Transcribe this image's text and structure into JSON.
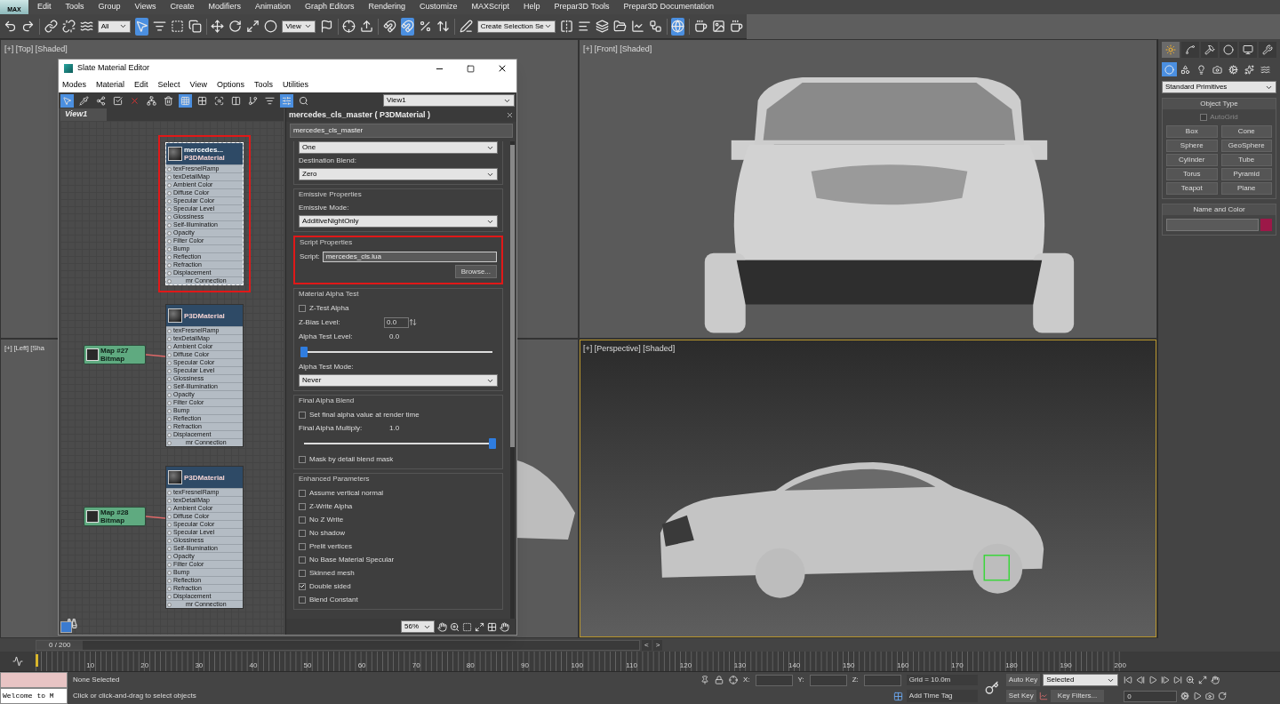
{
  "menu_bar": {
    "logo": "MAX",
    "items": [
      "Edit",
      "Tools",
      "Group",
      "Views",
      "Create",
      "Modifiers",
      "Animation",
      "Graph Editors",
      "Rendering",
      "Customize",
      "MAXScript",
      "Help",
      "Prepar3D Tools",
      "Prepar3D Documentation"
    ]
  },
  "toolbar": [
    {
      "kind": "button",
      "selected": false
    },
    {
      "kind": "button",
      "selected": false
    },
    {
      "kind": "sep"
    },
    {
      "kind": "button",
      "selected": false
    },
    {
      "kind": "button",
      "selected": false
    },
    {
      "kind": "button",
      "selected": false
    },
    {
      "kind": "dropdown",
      "value": "All"
    },
    {
      "kind": "button",
      "selected": true
    },
    {
      "kind": "button",
      "selected": false
    },
    {
      "kind": "button",
      "selected": false
    },
    {
      "kind": "button",
      "selected": false
    },
    {
      "kind": "sep"
    },
    {
      "kind": "button",
      "selected": false
    },
    {
      "kind": "button",
      "selected": false
    },
    {
      "kind": "button",
      "selected": false
    },
    {
      "kind": "button",
      "selected": false
    },
    {
      "kind": "dropdown",
      "value": "View"
    },
    {
      "kind": "button",
      "selected": false
    },
    {
      "kind": "sep"
    },
    {
      "kind": "button",
      "selected": false
    },
    {
      "kind": "button",
      "selected": false
    },
    {
      "kind": "sep"
    },
    {
      "kind": "button",
      "selected": false
    },
    {
      "kind": "button",
      "selected": true
    },
    {
      "kind": "button",
      "selected": false
    },
    {
      "kind": "button",
      "selected": false
    },
    {
      "kind": "sep"
    },
    {
      "kind": "button",
      "selected": false
    },
    {
      "kind": "dropdown",
      "value": "Create Selection Se"
    },
    {
      "kind": "button",
      "selected": false
    },
    {
      "kind": "button",
      "selected": false
    },
    {
      "kind": "button",
      "selected": false
    },
    {
      "kind": "button",
      "selected": false
    },
    {
      "kind": "button",
      "selected": false
    },
    {
      "kind": "button",
      "selected": false
    },
    {
      "kind": "sep"
    },
    {
      "kind": "button",
      "selected": true
    },
    {
      "kind": "sep"
    },
    {
      "kind": "button",
      "selected": false
    },
    {
      "kind": "button",
      "selected": false
    },
    {
      "kind": "button",
      "selected": false
    }
  ],
  "viewports": [
    {
      "label": "[+] [Top] [Shaded]",
      "kind": "top",
      "active": false
    },
    {
      "label": "[+] [Front] [Shaded]",
      "kind": "front",
      "active": false
    },
    {
      "label": "[+] [Left] [Sha",
      "kind": "left",
      "active": false
    },
    {
      "label": "[+] [Perspective] [Shaded]",
      "kind": "perspective",
      "active": true
    }
  ],
  "material_editor": {
    "title": "Slate Material Editor",
    "menu": [
      "Modes",
      "Material",
      "Edit",
      "Select",
      "View",
      "Options",
      "Tools",
      "Utilities"
    ],
    "toolbar": [
      {
        "selected": true
      },
      {
        "selected": false
      },
      {
        "selected": false
      },
      {
        "selected": false
      },
      {
        "selected": false
      },
      {
        "selected": false
      },
      {
        "selected": false
      },
      {
        "selected": true
      },
      {
        "selected": false
      },
      {
        "selected": false
      },
      {
        "selected": false
      },
      {
        "selected": false
      },
      {
        "selected": false
      },
      {
        "selected": true
      },
      {
        "selected": false
      }
    ],
    "view_dropdown": "View1",
    "view_tab": "View1",
    "nodes": [
      {
        "title": "mercedes...",
        "subtitle": "P3DMaterial",
        "selected": true,
        "highlighted": true,
        "slots": [
          "texFresnelRamp",
          "texDetailMap",
          "Ambient Color",
          "Diffuse Color",
          "Specular Color",
          "Specular Level",
          "Glossiness",
          "Self-Illumination",
          "Opacity",
          "Filter Color",
          "Bump",
          "Reflection",
          "Refraction",
          "Displacement",
          "mr Connection"
        ]
      },
      {
        "subtitle": "P3DMaterial",
        "selected": false,
        "highlighted": false,
        "slots": [
          "texFresnelRamp",
          "texDetailMap",
          "Ambient Color",
          "Diffuse Color",
          "Specular Color",
          "Specular Level",
          "Glossiness",
          "Self-Illumination",
          "Opacity",
          "Filter Color",
          "Bump",
          "Reflection",
          "Refraction",
          "Displacement",
          "mr Connection"
        ]
      },
      {
        "subtitle": "P3DMaterial",
        "selected": false,
        "highlighted": false,
        "slots": [
          "texFresnelRamp",
          "texDetailMap",
          "Ambient Color",
          "Diffuse Color",
          "Specular Color",
          "Specular Level",
          "Glossiness",
          "Self-Illumination",
          "Opacity",
          "Filter Color",
          "Bump",
          "Reflection",
          "Refraction",
          "Displacement",
          "mr Connection"
        ]
      }
    ],
    "maps": [
      {
        "title": "Map #27",
        "subtitle": "Bitmap"
      },
      {
        "title": "Map #28",
        "subtitle": "Bitmap"
      }
    ],
    "panel": {
      "header": "mercedes_cls_master ( P3DMaterial )",
      "name": "mercedes_cls_master",
      "sections": [
        {
          "highlighted": false,
          "rows": [
            {
              "kind": "dropdown",
              "value": "One"
            },
            {
              "kind": "label",
              "text": "Destination Blend:"
            },
            {
              "kind": "dropdown",
              "value": "Zero"
            }
          ]
        },
        {
          "title": "Emissive Properties",
          "highlighted": false,
          "rows": [
            {
              "kind": "label",
              "text": "Emissive Mode:"
            },
            {
              "kind": "dropdown",
              "value": "AdditiveNightOnly"
            }
          ]
        },
        {
          "title": "Script Properties",
          "highlighted": true,
          "rows": [
            {
              "kind": "field",
              "label": "Script:",
              "value": "mercedes_cls.lua"
            },
            {
              "kind": "button",
              "text": "Browse..."
            }
          ]
        },
        {
          "title": "Material Alpha Test",
          "highlighted": false,
          "rows": [
            {
              "kind": "checkbox",
              "text": "Z-Test Alpha",
              "checked": false
            },
            {
              "kind": "spinner",
              "label": "Z-Bias Level:",
              "value": "0.0"
            },
            {
              "kind": "reading",
              "label": "Alpha Test Level:",
              "value": "0.0"
            },
            {
              "kind": "slider",
              "level": 0
            },
            {
              "kind": "label",
              "text": "Alpha Test Mode:"
            },
            {
              "kind": "dropdown",
              "value": "Never"
            }
          ]
        },
        {
          "title": "Final Alpha Blend",
          "highlighted": false,
          "rows": [
            {
              "kind": "checkbox",
              "text": "Set final alpha value at render time",
              "checked": false
            },
            {
              "kind": "reading",
              "label": "Final Alpha Multiply:",
              "value": "1.0"
            },
            {
              "kind": "slider",
              "level": 1
            },
            {
              "kind": "checkbox",
              "text": "Mask by detail blend mask",
              "checked": false
            }
          ]
        },
        {
          "title": "Enhanced Parameters",
          "highlighted": false,
          "rows": [
            {
              "kind": "checkbox",
              "text": "Assume vertical normal",
              "checked": false
            },
            {
              "kind": "checkbox",
              "text": "Z-Write Alpha",
              "checked": false
            },
            {
              "kind": "checkbox",
              "text": "No Z Write",
              "checked": false
            },
            {
              "kind": "checkbox",
              "text": "No shadow",
              "checked": false
            },
            {
              "kind": "checkbox",
              "text": "Prelit vertices",
              "checked": false
            },
            {
              "kind": "checkbox",
              "text": "No Base Material Specular",
              "checked": false
            },
            {
              "kind": "checkbox",
              "text": "Skinned mesh",
              "checked": false
            },
            {
              "kind": "checkbox",
              "text": "Double sided",
              "checked": true
            },
            {
              "kind": "checkbox",
              "text": "Blend Constant",
              "checked": false
            }
          ]
        }
      ]
    },
    "zoom": "56%"
  },
  "command_panel": {
    "tabs": [
      {
        "selected": true
      },
      {
        "selected": false
      },
      {
        "selected": false
      },
      {
        "selected": false
      },
      {
        "selected": false
      },
      {
        "selected": false
      }
    ],
    "categories": [
      {
        "selected": true
      },
      {
        "selected": false
      },
      {
        "selected": false
      },
      {
        "selected": false
      },
      {
        "selected": false
      },
      {
        "selected": false
      },
      {
        "selected": false
      }
    ],
    "dropdown": "Standard Primitives",
    "object_type": {
      "title": "Object Type",
      "autogrid": {
        "label": "AutoGrid",
        "checked": false
      },
      "buttons": [
        "Box",
        "Cone",
        "Sphere",
        "GeoSphere",
        "Cylinder",
        "Tube",
        "Torus",
        "Pyramid",
        "Teapot",
        "Plane"
      ]
    },
    "name_and_color": {
      "title": "Name and Color",
      "color": "#9c1848"
    }
  },
  "timeline": {
    "position": "0 / 200",
    "level": 0,
    "prev": "<",
    "next": ">",
    "ticks": [
      "10",
      "20",
      "30",
      "40",
      "50",
      "60",
      "70",
      "80",
      "90",
      "100",
      "110",
      "120",
      "130",
      "140",
      "150",
      "160",
      "170",
      "180",
      "190",
      "200"
    ]
  },
  "status_bar": {
    "listener_output": "Welcome to M",
    "selection": "None Selected",
    "prompt": "Click or click-and-drag to select objects",
    "x_label": "X:",
    "y_label": "Y:",
    "z_label": "Z:",
    "grid": "Grid = 10.0m",
    "add_time_tag": "Add Time Tag",
    "auto_key": "Auto Key",
    "key_mode": "Selected",
    "set_key": "Set Key",
    "key_filters": "Key Filters...",
    "frame": "0"
  }
}
